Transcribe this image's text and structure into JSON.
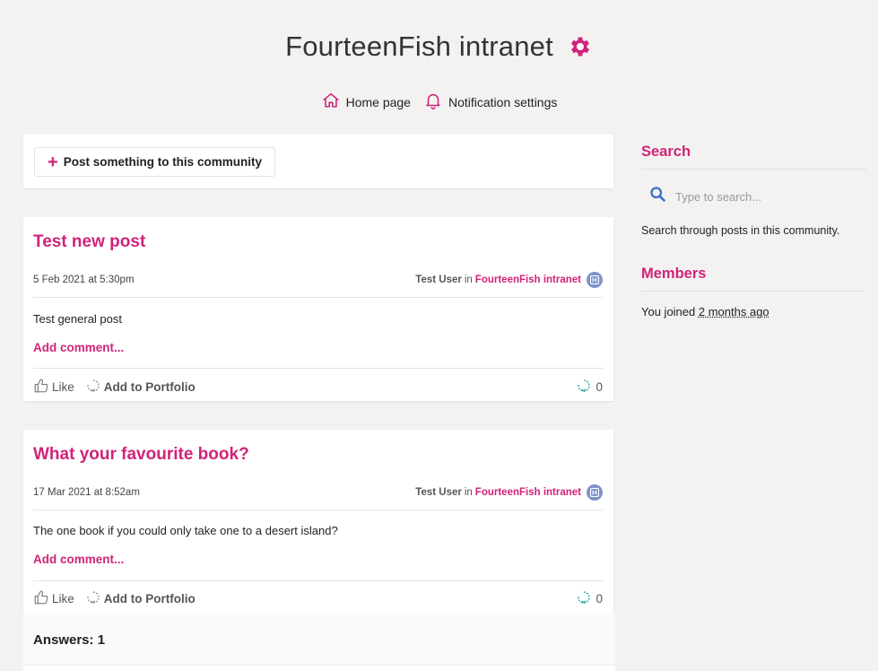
{
  "header": {
    "title": "FourteenFish intranet",
    "nav": [
      {
        "label": "Home page",
        "icon": "home-icon"
      },
      {
        "label": "Notification settings",
        "icon": "bell-icon"
      }
    ]
  },
  "composer": {
    "post_label": "Post something to this community"
  },
  "posts": [
    {
      "title": "Test new post",
      "date": "5 Feb 2021 at 5:30pm",
      "author": "Test User",
      "in_word": "in",
      "community": "FourteenFish intranet",
      "body": "Test general post",
      "add_comment": "Add comment...",
      "like_label": "Like",
      "portfolio_label": "Add to Portfolio",
      "count": "0"
    },
    {
      "title": "What your favourite book?",
      "date": "17 Mar 2021 at 8:52am",
      "author": "Test User",
      "in_word": "in",
      "community": "FourteenFish intranet",
      "body": "The one book if you could only take one to a desert island?",
      "add_comment": "Add comment...",
      "like_label": "Like",
      "portfolio_label": "Add to Portfolio",
      "count": "0",
      "answers": "Answers: 1"
    }
  ],
  "sidebar": {
    "search_heading": "Search",
    "search_placeholder": "Type to search...",
    "search_help": "Search through posts in this community.",
    "members_heading": "Members",
    "joined_prefix": "You joined",
    "joined_ago": "2 months ago"
  },
  "colors": {
    "accent": "#d0237a",
    "teal": "#1aa89a",
    "badge": "#7d93c9",
    "search_icon": "#3a6fc4"
  }
}
